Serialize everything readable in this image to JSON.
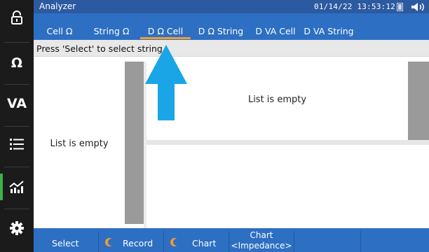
{
  "titlebar": {
    "app_title": "Analyzer",
    "clock": "01/14/22  13:53:12"
  },
  "tabs": [
    {
      "label": "Cell Ω",
      "active": false
    },
    {
      "label": "String Ω",
      "active": false
    },
    {
      "label": "D Ω Cell",
      "active": true
    },
    {
      "label": "D Ω String",
      "active": false
    },
    {
      "label": "D VA Cell",
      "active": false
    },
    {
      "label": "D VA String",
      "active": false
    }
  ],
  "rail": {
    "items": [
      {
        "icon": "lock-icon"
      },
      {
        "icon": "ohm-icon",
        "text": "Ω"
      },
      {
        "icon": "va-icon",
        "text": "VA"
      },
      {
        "icon": "list-icon"
      },
      {
        "icon": "analyzer-chart-icon",
        "active": true
      },
      {
        "icon": "gear-icon"
      }
    ]
  },
  "status": {
    "message": "Press 'Select' to select string."
  },
  "panes": {
    "left_empty": "List is empty",
    "right_empty": "List is empty"
  },
  "softkeys": {
    "select": "Select",
    "record": "Record",
    "chart": "Chart",
    "chart_mode_line1": "Chart",
    "chart_mode_line2": "<Impedance>"
  },
  "colors": {
    "titlebar": "#2c5aa0",
    "tabbar": "#2d6fc2",
    "active_tab_underline": "#f29b30",
    "rail": "#1b1b1b",
    "rail_active_indicator": "#3bb34a",
    "arrow": "#1aa6e6",
    "scrollbar": "#9a9a9a",
    "softkey_toggle": "#f29b30"
  }
}
